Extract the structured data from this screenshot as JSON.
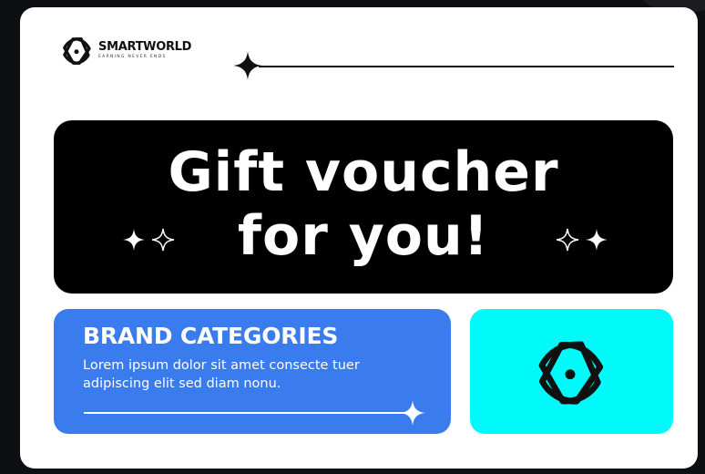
{
  "brand": {
    "name": "SMARTWORLD",
    "tagline": "EARNING NEVER ENDS",
    "logo_icon": "orbit-logo-icon"
  },
  "hero": {
    "line1": "Gift voucher",
    "line2": "for you!",
    "decorations": [
      "sparkle-icon",
      "sparkle-outline-icon"
    ]
  },
  "categories": {
    "title": "BRAND CATEGORIES",
    "body": "Lorem ipsum dolor sit amet consecte tuer adipiscing elit sed diam nonu."
  },
  "colors": {
    "background": "#0e0f12",
    "card": "#ffffff",
    "hero": "#000000",
    "blue_card": "#3a7bee",
    "cyan_card": "#00f9f9",
    "ink": "#111111"
  }
}
